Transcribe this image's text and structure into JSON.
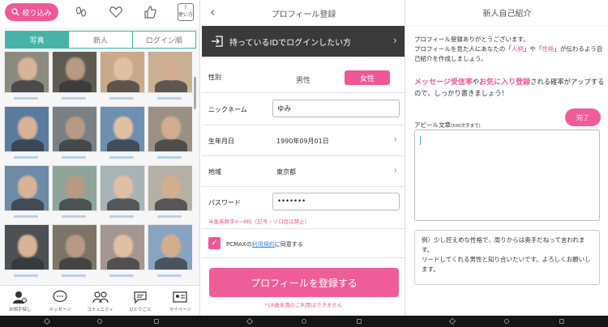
{
  "panel1": {
    "filter_label": "絞り込み",
    "help_label": "?\n使い方",
    "tabs": [
      "写真",
      "新人",
      "ログイン順"
    ],
    "active_tab": "写真",
    "bottom_nav": [
      "お相手探し",
      "メッセージ",
      "コミュニティ",
      "ひとりごと",
      "マイページ"
    ],
    "accent_color": "#ef5896",
    "tab_color": "#46b3a7"
  },
  "panel2": {
    "title": "プロフィール登録",
    "id_login": "持っているIDでログインしたい方",
    "gender_label": "性別",
    "gender_male": "男性",
    "gender_female": "女性",
    "selected_gender": "女性",
    "nickname_label": "ニックネーム",
    "nickname_value": "ゆみ",
    "birthday_label": "生年月日",
    "birthday_value": "1990年09月01日",
    "region_label": "地域",
    "region_value": "東京都",
    "password_label": "パスワード",
    "password_value": "•••••••",
    "password_hint": "半角英数字4～8桁（記号・ゾロ目は禁止）",
    "agree_prefix": "PCMAXの",
    "agree_link": "利用規約",
    "agree_suffix": "に同意する",
    "agree_checked": true,
    "register_button": "プロフィールを登録する",
    "age_notice": "*18歳未満のご利用はできません"
  },
  "panel3": {
    "title": "新人自己紹介",
    "intro_1": "プロフィール登録ありがとうございます。",
    "intro_2a": "プロフィールを見た人にあなたの「",
    "kw_personality": "人柄",
    "intro_2b": "」や「",
    "kw_character": "性格",
    "intro_2c": "」が伝わるよう自己紹介を作成しましょう。",
    "emph_1": "メッセージ受信率",
    "emph_join": "や",
    "emph_2": "お気に入り登録",
    "emph_rest": "される確率がアップするので、しっかり書きましょう！",
    "appeal_label": "アピール文章",
    "appeal_note": "(500文字まで)",
    "done_button": "完了",
    "example_text": "例）少し控えめな性格で、周りからは奥手だねって言われます。\nリードしてくれる男性と知り合いたいです。よろしくお願いします。"
  }
}
